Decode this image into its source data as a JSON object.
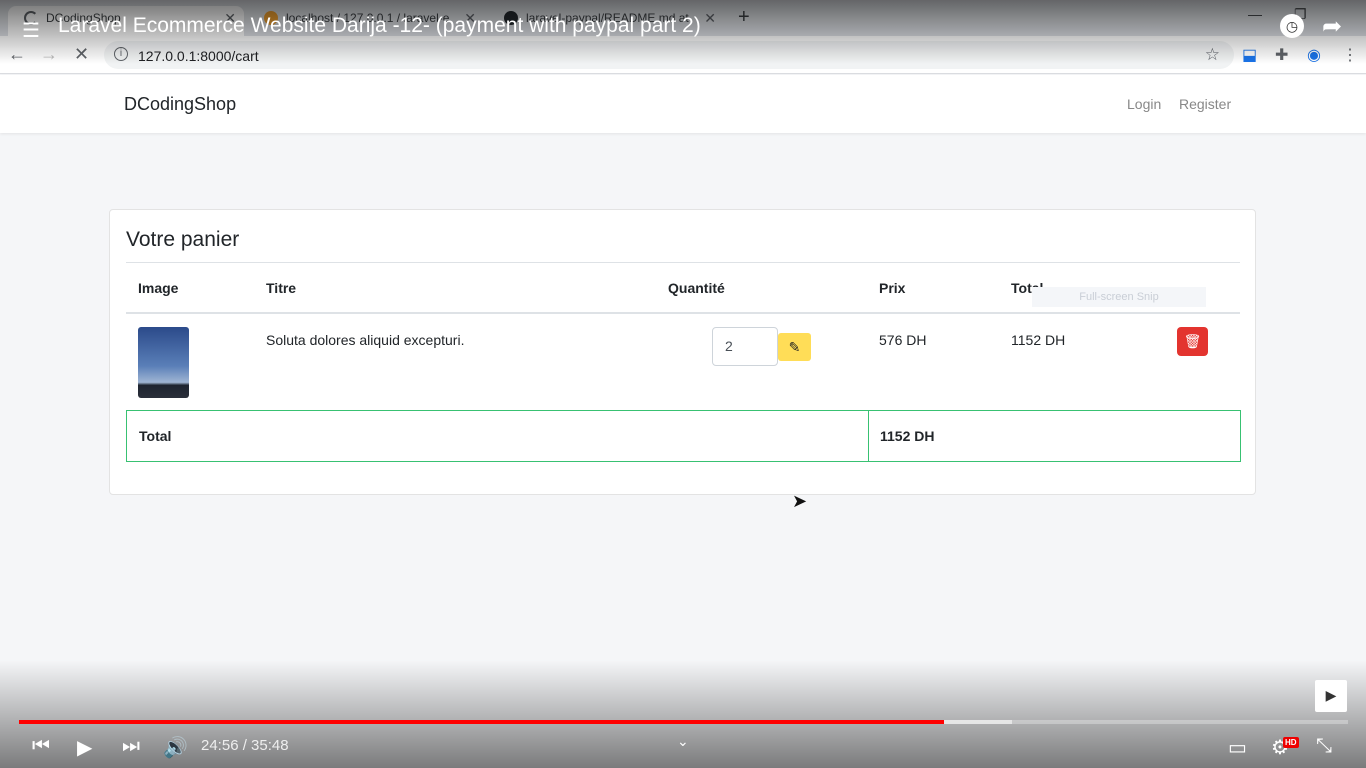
{
  "browser": {
    "tabs": [
      {
        "title": "DCodingShop",
        "active": true
      },
      {
        "title": "localhost / 127.0.0.1 / laravel-e",
        "active": false
      },
      {
        "title": "laravel-paypal/README.md at",
        "active": false
      }
    ],
    "url": "127.0.0.1:8000/cart"
  },
  "video": {
    "title": "Laravel Ecommerce Website Darija -12- (payment with paypal part 2)",
    "time": "24:56 / 35:48",
    "progress": 0.696,
    "buffered": 0.747
  },
  "site": {
    "brand": "DCodingShop",
    "nav": {
      "login": "Login",
      "register": "Register"
    }
  },
  "cart": {
    "title": "Votre panier",
    "headers": {
      "image": "Image",
      "title": "Titre",
      "quantity": "Quantité",
      "price": "Prix",
      "total": "Total"
    },
    "items": [
      {
        "title": "Soluta dolores aliquid excepturi.",
        "quantity": "2",
        "price": "576 DH",
        "total": "1152 DH"
      }
    ],
    "total_label": "Total",
    "total_value": "1152 DH"
  },
  "overlay": {
    "snip": "Full-screen Snip"
  },
  "colors": {
    "success_border": "#38c172",
    "edit_button": "#ffdd57",
    "delete_button": "#e3342f",
    "progress": "#ff0000"
  }
}
